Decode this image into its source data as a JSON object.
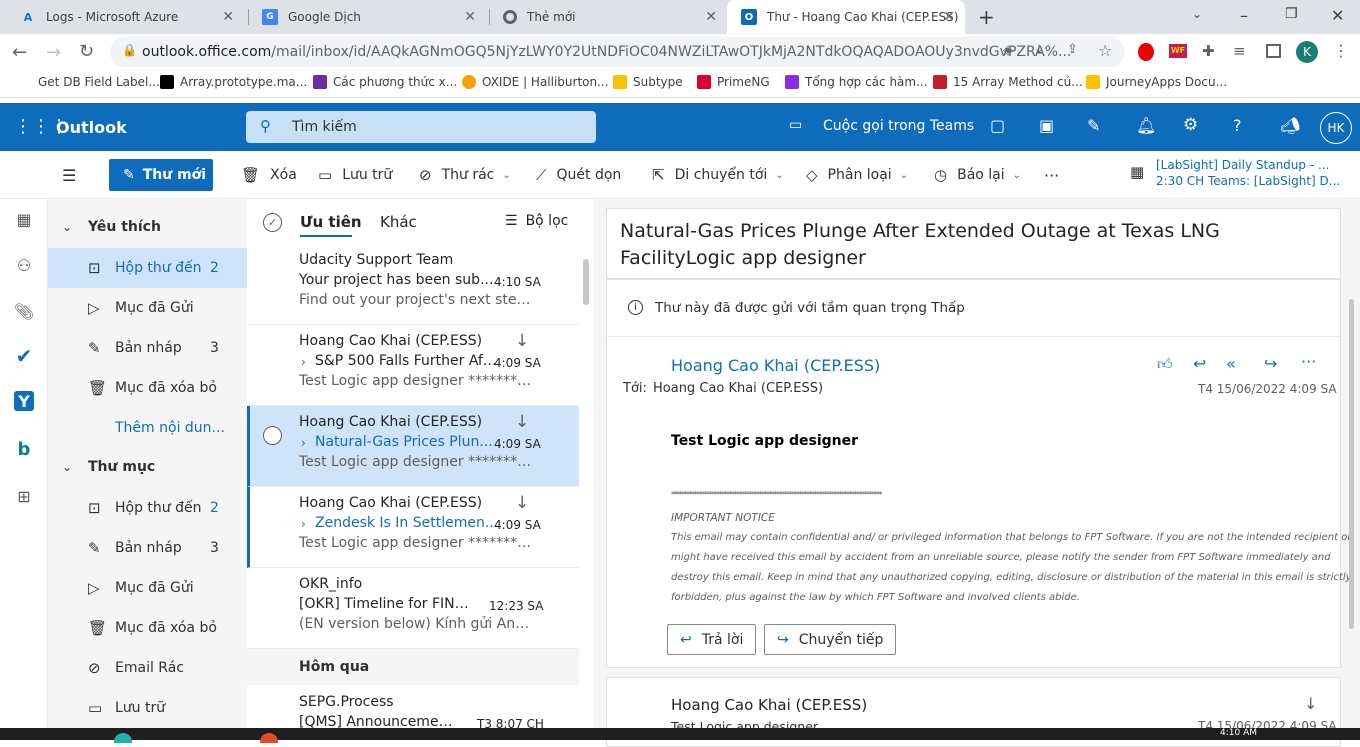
{
  "browser": {
    "tabs": [
      {
        "title": "Logs - Microsoft Azure",
        "icon": "azure-icon"
      },
      {
        "title": "Google Dịch",
        "icon": "google-translate-icon"
      },
      {
        "title": "Thẻ mới",
        "icon": "chrome-icon"
      },
      {
        "title": "Thư - Hoang Cao Khai (CEP.ESS)",
        "icon": "outlook-icon"
      }
    ],
    "url_host": "outlook.office.com",
    "url_path": "/mail/inbox/id/AAQkAGNmOGQ5NjYzLWY0Y2UtNDFiOC04NWZiLTAwOTJkMjA2NTdkOQAQADOAOUy3nvdGvPZRA%...",
    "profile_initial": "K",
    "bookmarks": [
      "Get DB Field Label...",
      "Array.prototype.ma...",
      "Các phương thức x...",
      "OXIDE | Halliburton...",
      "Subtype",
      "PrimeNG",
      "Tổng hợp các hàm...",
      "15 Array Method củ...",
      "JourneyApps Docu..."
    ]
  },
  "outlook": {
    "brand": "Outlook",
    "search_placeholder": "Tìm kiếm",
    "teams_call": "Cuộc gọi trong Teams",
    "avatar_initials": "HK",
    "accent": "#0f6cbd"
  },
  "ribbon": {
    "new_mail": "Thư mới",
    "delete": "Xóa",
    "archive": "Lưu trữ",
    "junk": "Thư rác",
    "sweep": "Quét dọn",
    "move_to": "Di chuyển tới",
    "categorize": "Phân loại",
    "snooze": "Báo lại",
    "meeting_title": "[LabSight] Daily Standup - ...",
    "meeting_detail": "2:30 CH Teams: [LabSight] D..."
  },
  "folders": {
    "favorites_header": "Yêu thích",
    "favorites": [
      {
        "label": "Hộp thư đến",
        "count": "2"
      },
      {
        "label": "Mục đã Gửi",
        "count": ""
      },
      {
        "label": "Bản nháp",
        "count": "3"
      },
      {
        "label": "Mục đã xóa bỏ",
        "count": ""
      }
    ],
    "add_more": "Thêm nội dun...",
    "folders_header": "Thư mục",
    "folder_items": [
      {
        "label": "Hộp thư đến",
        "count": "2"
      },
      {
        "label": "Bản nháp",
        "count": "3"
      },
      {
        "label": "Mục đã Gửi",
        "count": ""
      },
      {
        "label": "Mục đã xóa bỏ",
        "count": ""
      },
      {
        "label": "Email Rác",
        "count": ""
      },
      {
        "label": "Lưu trữ",
        "count": ""
      }
    ]
  },
  "list": {
    "tab_focused": "Ưu tiên",
    "tab_other": "Khác",
    "filter": "Bộ lọc",
    "section_yesterday": "Hôm qua",
    "messages": [
      {
        "sender": "Udacity Support Team",
        "subject": "Your project has been sub...",
        "time": "4:10 SA",
        "preview": "Find out your project's next steps.   ..."
      },
      {
        "sender": "Hoang Cao Khai (CEP.ESS)",
        "subject": "S&P 500 Falls Further Aft...",
        "time": "4:09 SA",
        "preview": "Test Logic app designer ************..."
      },
      {
        "sender": "Hoang Cao Khai (CEP.ESS)",
        "subject": "Natural-Gas Prices Plun...",
        "time": "4:09 SA",
        "preview": "Test Logic app designer ************..."
      },
      {
        "sender": "Hoang Cao Khai (CEP.ESS)",
        "subject": "Zendesk Is In Settlemen...",
        "time": "4:09 SA",
        "preview": "Test Logic app designer ************..."
      },
      {
        "sender": "OKR_info",
        "subject": "[OKR] Timeline for FINAL ...",
        "time": "12:23 SA",
        "preview": "(EN version below) Kính gửi Anh/Chị..."
      },
      {
        "sender": "SEPG.Process",
        "subject": "[QMS] Announcement ...",
        "time": "T3 8:07 CH",
        "preview": ""
      }
    ]
  },
  "reading": {
    "subject": "Natural-Gas Prices Plunge After Extended Outage at Texas LNG FacilityLogic app designer",
    "importance": "Thư này đã được gửi với tầm quan trọng Thấp",
    "sender": "Hoang Cao Khai (CEP.ESS)",
    "to_label": "Tới:",
    "to": "Hoang Cao Khai (CEP.ESS)",
    "date": "T4 15/06/2022 4:09 SA",
    "body_title": "Test Logic app designer",
    "stars": "************************************************************************************",
    "notice_title": "IMPORTANT NOTICE",
    "notice_lines": [
      "This email may contain confidential and/ or privileged information that belongs to FPT Software. If you are not the intended recipient or",
      "might have received this email by accident from an unreliable source, please notify the sender from FPT Software immediately and",
      "destroy this email. Keep in mind that any unauthorized copying, editing, disclosure or distribution of the material in this email is strictly",
      "forbidden, plus against the law by which FPT Software and involved clients abide."
    ],
    "reply": "Trả lời",
    "forward": "Chuyển tiếp",
    "second_sender": "Hoang Cao Khai (CEP.ESS)",
    "second_preview": "Test Logic app designer",
    "second_date": "T4 15/06/2022 4:09 SA"
  },
  "taskbar": {
    "time": "4:10 AM"
  }
}
